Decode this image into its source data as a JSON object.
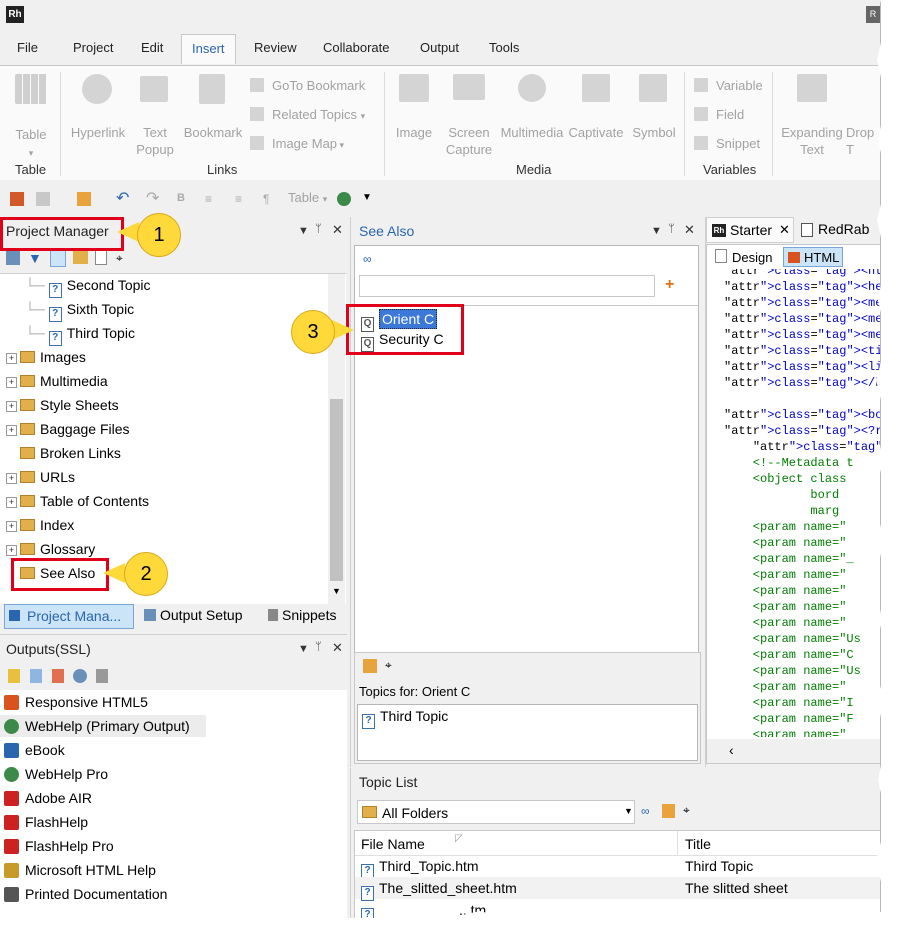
{
  "app": {
    "logo": "Rh",
    "logo_right": "R"
  },
  "menu": {
    "tabs": [
      "File",
      "Project",
      "Edit",
      "Insert",
      "Review",
      "Collaborate",
      "Output",
      "Tools"
    ],
    "active": "Insert"
  },
  "ribbon": {
    "table_group": {
      "button": "Table",
      "label": "Table"
    },
    "links_group": {
      "hyperlink": "Hyperlink",
      "text_popup_1": "Text",
      "text_popup_2": "Popup",
      "bookmark": "Bookmark",
      "goto_bookmark": "GoTo Bookmark",
      "related_topics": "Related Topics",
      "image_map": "Image Map",
      "label": "Links"
    },
    "media_group": {
      "image": "Image",
      "screen_capture_1": "Screen",
      "screen_capture_2": "Capture",
      "multimedia": "Multimedia",
      "captivate": "Captivate",
      "symbol": "Symbol",
      "label": "Media"
    },
    "variables_group": {
      "variable": "Variable",
      "field": "Field",
      "snippet": "Snippet",
      "label": "Variables"
    },
    "more": {
      "expanding_1": "Expanding",
      "expanding_2": "Text",
      "drop_1": "Drop",
      "drop_2": "T"
    }
  },
  "qat": {
    "table_label": "Table"
  },
  "project_manager": {
    "title": "Project Manager",
    "items": [
      {
        "label": "Second Topic",
        "type": "topic"
      },
      {
        "label": "Sixth Topic",
        "type": "topic"
      },
      {
        "label": "Third Topic",
        "type": "topic"
      },
      {
        "label": "Images",
        "type": "folder"
      },
      {
        "label": "Multimedia",
        "type": "folder"
      },
      {
        "label": "Style Sheets",
        "type": "folder"
      },
      {
        "label": "Baggage Files",
        "type": "folder"
      },
      {
        "label": "Broken Links",
        "type": "folder"
      },
      {
        "label": "URLs",
        "type": "folder"
      },
      {
        "label": "Table of Contents",
        "type": "folder"
      },
      {
        "label": "Index",
        "type": "folder"
      },
      {
        "label": "Glossary",
        "type": "folder"
      },
      {
        "label": "See Also",
        "type": "folder"
      }
    ],
    "bottom_tabs": [
      "Project Mana...",
      "Output Setup",
      "Snippets"
    ]
  },
  "outputs": {
    "title": "Outputs(SSL)",
    "items": [
      {
        "label": "Responsive HTML5",
        "color": "#d9531e"
      },
      {
        "label": "WebHelp (Primary Output)",
        "color": "#3c8a4a"
      },
      {
        "label": "eBook",
        "color": "#2a65b0"
      },
      {
        "label": "WebHelp Pro",
        "color": "#3c8a4a"
      },
      {
        "label": "Adobe AIR",
        "color": "#cc2222"
      },
      {
        "label": "FlashHelp",
        "color": "#cc2222"
      },
      {
        "label": "FlashHelp Pro",
        "color": "#cc2222"
      },
      {
        "label": "Microsoft HTML Help",
        "color": "#c79a2a"
      },
      {
        "label": "Printed Documentation",
        "color": "#555555"
      }
    ]
  },
  "see_also": {
    "title": "See Also",
    "input_value": "",
    "items": [
      "Orient C",
      "Security C"
    ],
    "topics_for_label": "Topics for: Orient C",
    "topics": [
      "Third Topic"
    ]
  },
  "editor": {
    "tabs": [
      "Starter",
      "RedRab"
    ],
    "view_tabs": [
      "Design",
      "HTML"
    ],
    "code_lines": [
      "<html xmlns=\"http",
      "<head>",
      "<meta http-equiv=\"",
      "<meta name=\"topic-",
      "<meta name=\"genera",
      "<title>Footer</tit",
      "<link rel=\"StyleS",
      "</head>",
      "",
      "<body>",
      "<?rh-region_start",
      "    <p>Here is an",
      "    <!--Metadata t",
      "    <object class",
      "            bord",
      "            marg",
      "    <param name=\"",
      "    <param name=\"",
      "    <param name=\"_",
      "    <param name=\"",
      "    <param name=\"",
      "    <param name=\"",
      "    <param name=\"",
      "    <param name=\"Us",
      "    <param name=\"C",
      "    <param name=\"Us",
      "    <param name=\"",
      "    <param name=\"I",
      "    <param name=\"F",
      "    <param name=\""
    ]
  },
  "topic_list": {
    "title": "Topic List",
    "folder_select": "All Folders",
    "columns": [
      "File Name",
      "Title"
    ],
    "rows": [
      {
        "file": "Third_Topic.htm",
        "title": "Third Topic"
      },
      {
        "file": "The_slitted_sheet.htm",
        "title": "The slitted sheet"
      },
      {
        "file": "...tm",
        "title": ""
      }
    ]
  },
  "callouts": [
    "1",
    "2",
    "3"
  ],
  "colors": {
    "accent": "#2a65b0",
    "highlight": "#e0001a",
    "callout": "#ffd83a",
    "selection": "#cce4f7"
  }
}
